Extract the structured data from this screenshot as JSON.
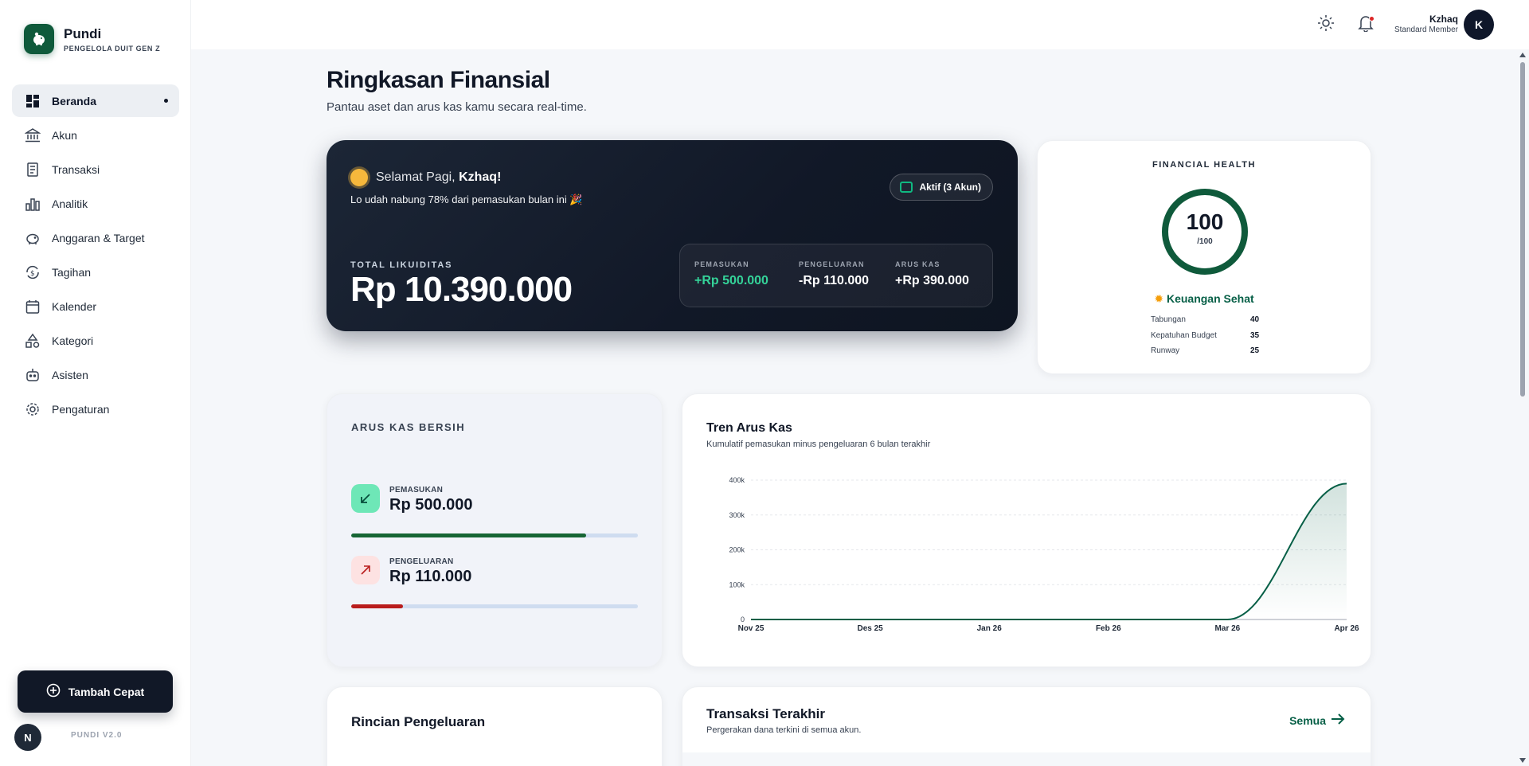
{
  "brand": {
    "name": "Pundi",
    "tagline": "PENGELOLA DUIT GEN Z"
  },
  "sidebar": {
    "items": [
      {
        "label": "Beranda",
        "icon": "dashboard-icon",
        "active": true
      },
      {
        "label": "Akun",
        "icon": "bank-icon"
      },
      {
        "label": "Transaksi",
        "icon": "receipt-icon"
      },
      {
        "label": "Analitik",
        "icon": "bar-chart-icon"
      },
      {
        "label": "Anggaran & Target",
        "icon": "piggy-bank-icon"
      },
      {
        "label": "Tagihan",
        "icon": "refresh-dollar-icon"
      },
      {
        "label": "Kalender",
        "icon": "calendar-icon"
      },
      {
        "label": "Kategori",
        "icon": "shapes-icon"
      },
      {
        "label": "Asisten",
        "icon": "robot-icon"
      },
      {
        "label": "Pengaturan",
        "icon": "gear-icon"
      }
    ],
    "quick_add": "Tambah Cepat",
    "footer_avatar": "N",
    "version": "PUNDI V2.0"
  },
  "header": {
    "user_name": "Kzhaq",
    "user_role": "Standard Member",
    "avatar_initial": "K"
  },
  "page": {
    "title": "Ringkasan Finansial",
    "subtitle": "Pantau aset dan arus kas kamu secara real-time."
  },
  "hero": {
    "greeting_prefix": "Selamat Pagi, ",
    "greeting_name": "Kzhaq!",
    "message": "Lo udah nabung 78% dari pemasukan bulan ini 🎉",
    "badge": "Aktif (3 Akun)",
    "total_label": "TOTAL LIKUIDITAS",
    "total_value": "Rp 10.390.000",
    "stats": [
      {
        "label": "PEMASUKAN",
        "value": "+Rp 500.000",
        "color": "#34d399"
      },
      {
        "label": "PENGELUARAN",
        "value": "-Rp 110.000",
        "color": "#ffffff"
      },
      {
        "label": "ARUS KAS",
        "value": "+Rp 390.000",
        "color": "#ffffff"
      }
    ]
  },
  "health": {
    "title": "FINANCIAL HEALTH",
    "score": "100",
    "max": "/100",
    "score_fraction": 1.0,
    "status": "Keuangan Sehat",
    "rows": [
      {
        "label": "Tabungan",
        "value": "40"
      },
      {
        "label": "Kepatuhan Budget",
        "value": "35"
      },
      {
        "label": "Runway",
        "value": "25"
      }
    ],
    "accent": "#0f5a3b"
  },
  "arus": {
    "title": "ARUS KAS BERSIH",
    "income_label": "PEMASUKAN",
    "income_value": "Rp 500.000",
    "income_fraction": 0.82,
    "expense_label": "PENGELUARAN",
    "expense_value": "Rp 110.000",
    "expense_fraction": 0.18
  },
  "trend": {
    "title": "Tren Arus Kas",
    "subtitle": "Kumulatif pemasukan minus pengeluaran 6 bulan terakhir"
  },
  "chart_data": {
    "type": "area",
    "categories": [
      "Nov 25",
      "Des 25",
      "Jan 26",
      "Feb 26",
      "Mar 26",
      "Apr 26"
    ],
    "values": [
      0,
      0,
      0,
      0,
      0,
      390000
    ],
    "y_ticks": [
      "0",
      "100k",
      "200k",
      "300k",
      "400k"
    ],
    "ylim": [
      0,
      400000
    ],
    "grid": true,
    "line_color": "#065f46"
  },
  "rincian": {
    "title": "Rincian Pengeluaran"
  },
  "transactions": {
    "title": "Transaksi Terakhir",
    "subtitle": "Pergerakan dana terkini di semua akun.",
    "link": "Semua"
  }
}
